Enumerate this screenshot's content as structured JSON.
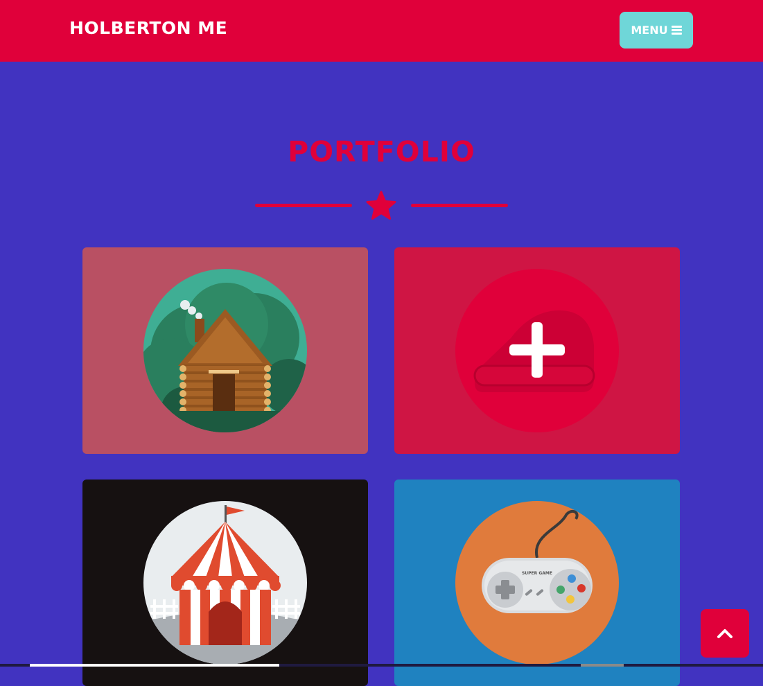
{
  "navbar": {
    "brand": "HOLBERTON ME",
    "menu_label": "MENU",
    "menu_icon": "bars-icon"
  },
  "portfolio": {
    "title": "PORTFOLIO",
    "divider_icon": "star-icon",
    "items": [
      {
        "name": "cabin",
        "icon": "log-cabin-illustration",
        "bg_color": "#b95063"
      },
      {
        "name": "cake",
        "icon": "cake-illustration",
        "bg_color": "#cf1544",
        "hovered": true,
        "overlay_icon": "plus-icon"
      },
      {
        "name": "circus",
        "icon": "circus-tent-illustration",
        "bg_color": "#161111"
      },
      {
        "name": "game",
        "icon": "game-controller-illustration",
        "bg_color": "#1f82c0",
        "controller_label": "SUPER GAME"
      }
    ]
  },
  "scroll_top_icon": "chevron-up-icon",
  "colors": {
    "brand_red": "#e0003a",
    "background": "#4133c0",
    "menu_button": "#6fd6d8"
  }
}
